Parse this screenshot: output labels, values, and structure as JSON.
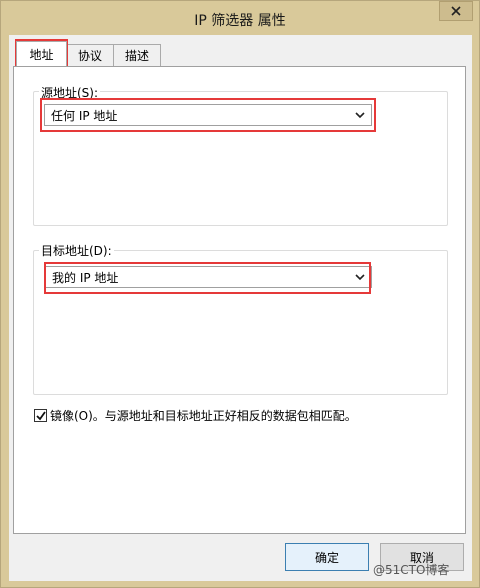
{
  "window": {
    "title": "IP 筛选器 属性"
  },
  "tabs": [
    {
      "label": "地址"
    },
    {
      "label": "协议"
    },
    {
      "label": "描述"
    }
  ],
  "source": {
    "label": "源地址(S):",
    "value": "任何 IP 地址"
  },
  "destination": {
    "label": "目标地址(D):",
    "value": "我的 IP 地址"
  },
  "mirror": {
    "label": "镜像(O)。与源地址和目标地址正好相反的数据包相匹配。",
    "checked": true
  },
  "buttons": {
    "ok": "确定",
    "cancel": "取消"
  },
  "watermark": "@51CTO博客",
  "colors": {
    "highlight": "#e53939",
    "title_bar": "#d9c99a"
  }
}
